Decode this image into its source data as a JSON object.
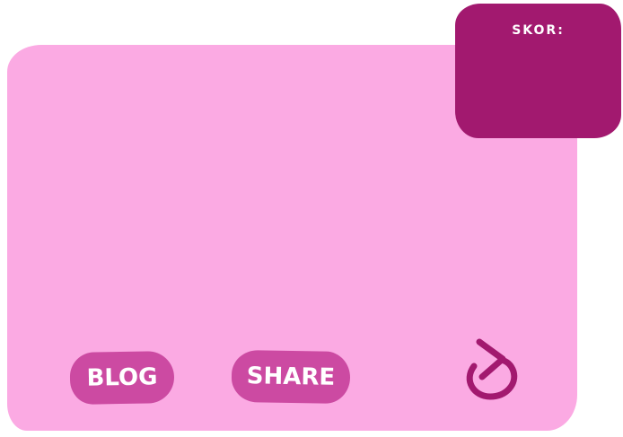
{
  "score": {
    "label": "SKOR:",
    "value": ""
  },
  "buttons": {
    "blog": "BLOG",
    "share": "SHARE"
  },
  "icons": {
    "restart": "restart-icon"
  },
  "colors": {
    "board": "#fbaae3",
    "score_panel": "#a2196f",
    "button": "#cc4aa2",
    "icon": "#a2196f",
    "text": "#ffffff"
  }
}
